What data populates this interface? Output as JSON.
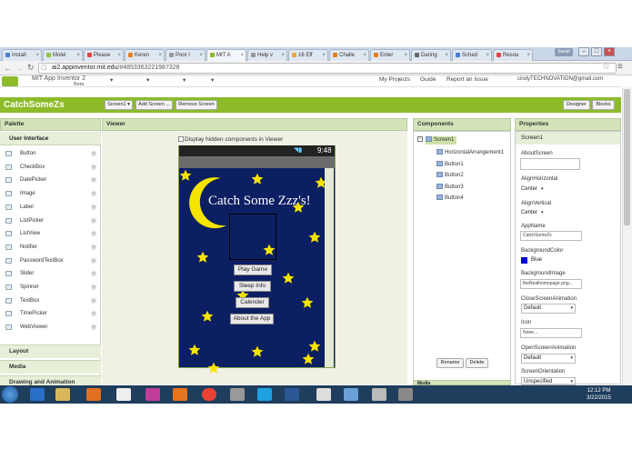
{
  "browser": {
    "tabs": [
      {
        "label": "Install",
        "color": "#4a7bd0"
      },
      {
        "label": "Molel",
        "color": "#8bc34a"
      },
      {
        "label": "Please",
        "color": "#d44"
      },
      {
        "label": "Keren",
        "color": "#e67e22"
      },
      {
        "label": "Poor l",
        "color": "#999"
      },
      {
        "label": "MIT A",
        "color": "#8dbb2a"
      },
      {
        "label": "Help v",
        "color": "#999"
      },
      {
        "label": "16 Eff",
        "color": "#e8a33c"
      },
      {
        "label": "Challe",
        "color": "#e67e22"
      },
      {
        "label": "Enter",
        "color": "#e67e22"
      },
      {
        "label": "Daring",
        "color": "#666"
      },
      {
        "label": "Sched",
        "color": "#4a7bd0"
      },
      {
        "label": "Resou",
        "color": "#d44"
      }
    ],
    "user_label": "Sarah",
    "url_host": "ai2.appinventor.mit.edu",
    "url_path": "/#4853363221987328"
  },
  "app_header": {
    "logo_title": "MIT App Inventor 2",
    "logo_sub": "Beta",
    "menus": [
      "Projects",
      "Connect",
      "Build",
      "Help"
    ],
    "links": [
      "My Projects",
      "Guide",
      "Report an Issue"
    ],
    "account": "cindyTECHNOVATION@gmail.com"
  },
  "project_bar": {
    "project_name": "CatchSomeZs",
    "screen_select": "Screen1",
    "add_screen": "Add Screen ...",
    "remove_screen": "Remove Screen",
    "designer": "Designer",
    "blocks": "Blocks"
  },
  "palette": {
    "title": "Palette",
    "group_ui": "User Interface",
    "items": [
      "Button",
      "CheckBox",
      "DatePicker",
      "Image",
      "Label",
      "ListPicker",
      "ListView",
      "Notifier",
      "PasswordTextBox",
      "Slider",
      "Spinner",
      "TextBox",
      "TimePicker",
      "WebViewer"
    ],
    "groups": [
      "Layout",
      "Media",
      "Drawing and Animation"
    ]
  },
  "viewer": {
    "title": "Viewer",
    "hidden_checkbox": "Display hidden components in Viewer",
    "time": "9:48",
    "app_title": "Catch Some Zzz's!",
    "buttons": [
      "Play Game",
      "Sleep Info",
      "Calender",
      "About the App"
    ]
  },
  "components": {
    "title": "Components",
    "root": "Screen1",
    "children": [
      "HorizontalArrangement1",
      "Button1",
      "Button2",
      "Button3",
      "Button4"
    ],
    "rename": "Rename",
    "delete": "Delete",
    "media_partial": "Media"
  },
  "properties": {
    "title": "Properties",
    "screen": "Screen1",
    "about_label": "AboutScreen",
    "align_h_label": "AlignHorizontal",
    "align_h_value": "Center",
    "align_v_label": "AlignVertical",
    "align_v_value": "Center",
    "appname_label": "AppName",
    "appname_value": "CatchSomeZs",
    "bgcolor_label": "BackgroundColor",
    "bgcolor_value": "Blue",
    "bgimage_label": "BackgroundImage",
    "bgimage_value": "theRealhomepage.png...",
    "close_anim_label": "CloseScreenAnimation",
    "close_anim_value": "Default",
    "icon_label": "Icon",
    "icon_value": "None...",
    "open_anim_label": "OpenScreenAnimation",
    "open_anim_value": "Default",
    "orientation_label": "ScreenOrientation",
    "orientation_value": "Unspecified"
  },
  "taskbar": {
    "time": "12:12 PM",
    "date": "3/22/2015"
  },
  "colors": {
    "appinventor_green": "#8dbb2a",
    "phone_bg": "#0d1f63",
    "star": "#f5e400"
  }
}
